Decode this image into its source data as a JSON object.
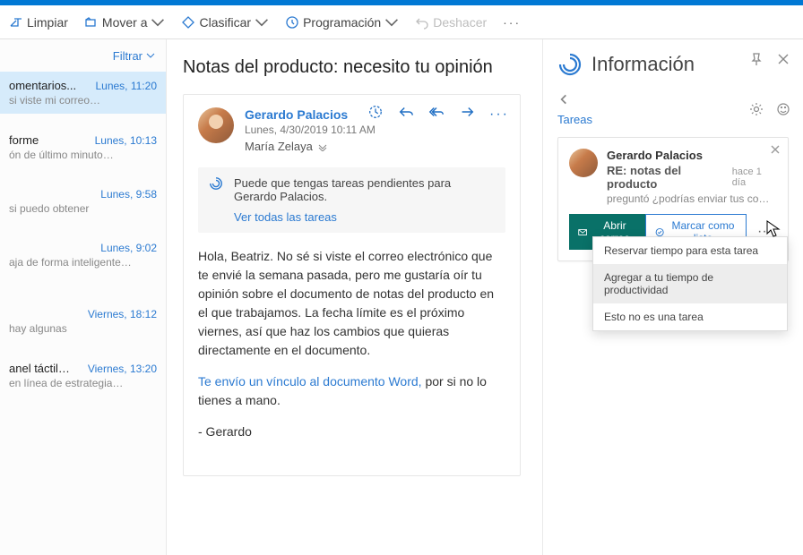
{
  "toolbar": {
    "limpiar": "Limpiar",
    "mover": "Mover a",
    "clasificar": "Clasificar",
    "programacion": "Programación",
    "deshacer": "Deshacer"
  },
  "filter_label": "Filtrar",
  "messages": [
    {
      "subject": "omentarios...",
      "time": "Lunes, 11:20",
      "preview": "si viste mi correo…",
      "selected": true
    },
    {
      "subject": "forme",
      "time": "Lunes, 10:13",
      "preview": "ón de último minuto…"
    },
    {
      "subject": "",
      "time": "Lunes, 9:58",
      "preview": "si puedo obtener"
    },
    {
      "subject": "",
      "time": "Lunes, 9:02",
      "preview": "aja de forma inteligente…"
    },
    {
      "subject": "",
      "time": "Viernes, 18:12",
      "preview": "hay algunas"
    },
    {
      "subject": "anel táctil…",
      "time": "Viernes, 13:20",
      "preview": "en línea de estrategia…"
    }
  ],
  "reader": {
    "title": "Notas del producto: necesito tu opinión",
    "sender": "Gerardo Palacios",
    "datetime": "Lunes, 4/30/2019 10:11 AM",
    "recipient": "María Zelaya",
    "task_notice": "Puede que tengas tareas pendientes para Gerardo Palacios.",
    "task_link": "Ver todas las tareas",
    "body_p1": "Hola, Beatriz. No sé si viste el correo electrónico que te envié la semana pasada, pero me gustaría oír tu opinión sobre el documento de notas del producto en el que trabajamos. La fecha límite es el próximo viernes, así que haz los cambios que quieras directamente en el documento.",
    "body_link": "Te envío un vínculo al documento Word,",
    "body_link_tail": " por si no lo tienes a mano.",
    "signoff": "- Gerardo"
  },
  "insights": {
    "title": "Información",
    "section": "Tareas",
    "task": {
      "name": "Gerardo Palacios",
      "subject": "RE: notas del producto",
      "age": "hace 1 día",
      "preview": "preguntó ¿podrías enviar tus co…",
      "open_btn": "Abrir correo",
      "done_btn": "Marcar como listo"
    },
    "menu": {
      "opt1": "Reservar tiempo para esta tarea",
      "opt2": "Agregar a tu tiempo de productividad",
      "opt3": "Esto no es una tarea"
    }
  }
}
